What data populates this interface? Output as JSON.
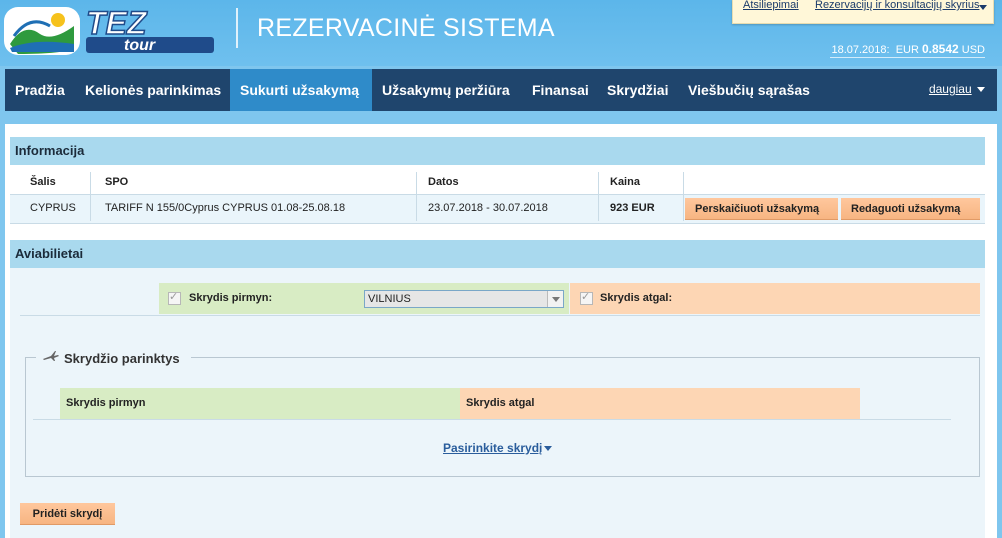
{
  "header": {
    "system_title": "REZERVACINĖ SISTEMA",
    "logo_text": "TEZ tour",
    "top_links": [
      "Atsiliepimai",
      "Rezervacijų ir konsultacijų skyrius"
    ],
    "date": "18.07.2018:",
    "currency_from": "EUR",
    "rate": "0.8542",
    "currency_to": "USD"
  },
  "nav": {
    "items": [
      "Pradžia",
      "Kelionės parinkimas",
      "Sukurti užsakymą",
      "Užsakymų peržiūra",
      "Finansai",
      "Skrydžiai",
      "Viešbučių sąrašas"
    ],
    "active": "Sukurti užsakymą",
    "more": "daugiau"
  },
  "info": {
    "title": "Informacija",
    "columns": [
      "Šalis",
      "SPO",
      "Datos",
      "Kaina"
    ],
    "row": {
      "country": "CYPRUS",
      "spo": "TARIFF N 155/0Cyprus CYPRUS 01.08-25.08.18",
      "dates": "23.07.2018 - 30.07.2018",
      "price": "923 EUR"
    },
    "buttons": [
      "Perskaičiuoti užsakymą",
      "Redaguoti užsakymą"
    ]
  },
  "avia": {
    "title": "Aviabilietai",
    "outbound_label": "Skrydis pirmyn:",
    "outbound_city": "VILNIUS",
    "return_label": "Skrydis atgal:",
    "options_title": "Skrydžio parinktys",
    "col_outbound": "Skrydis pirmyn",
    "col_return": "Skrydis atgal",
    "choose_link": "Pasirinkite skrydį",
    "add_button": "Pridėti skrydį"
  },
  "colors": {
    "nav_bg": "#1f456d",
    "nav_active": "#2f8bc9",
    "header_bg": "#6fc0ee",
    "panel_head": "#a9d9ee",
    "green": "#d8ecc4",
    "peach": "#fdd6b4"
  }
}
